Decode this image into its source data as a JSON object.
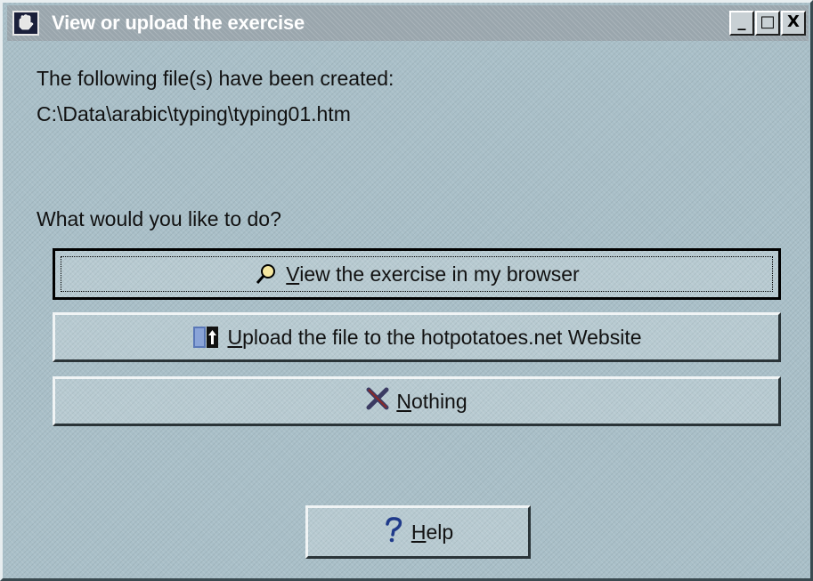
{
  "window": {
    "title": "View or upload the exercise",
    "controls": {
      "minimize": "_",
      "maximize": "□",
      "close": "X"
    }
  },
  "content": {
    "created_label": "The following file(s) have been created:",
    "file_path": "C:\\Data\\arabic\\typing\\typing01.htm",
    "question": "What would you like to do?"
  },
  "buttons": {
    "view": {
      "mnemonic": "V",
      "rest": "iew the exercise in my browser",
      "icon": "magnifier-icon"
    },
    "upload": {
      "mnemonic": "U",
      "rest": "pload the file to the hotpotatoes.net Website",
      "icon": "upload-icon"
    },
    "nothing": {
      "mnemonic": "N",
      "rest": "othing",
      "icon": "x-icon"
    },
    "help": {
      "mnemonic": "H",
      "rest": "elp",
      "icon": "question-icon"
    }
  },
  "colors": {
    "background": "#a9bfc8",
    "title_bar": "#9aa6ad",
    "title_text": "#ffffff",
    "help_icon": "#1f3a8a"
  }
}
